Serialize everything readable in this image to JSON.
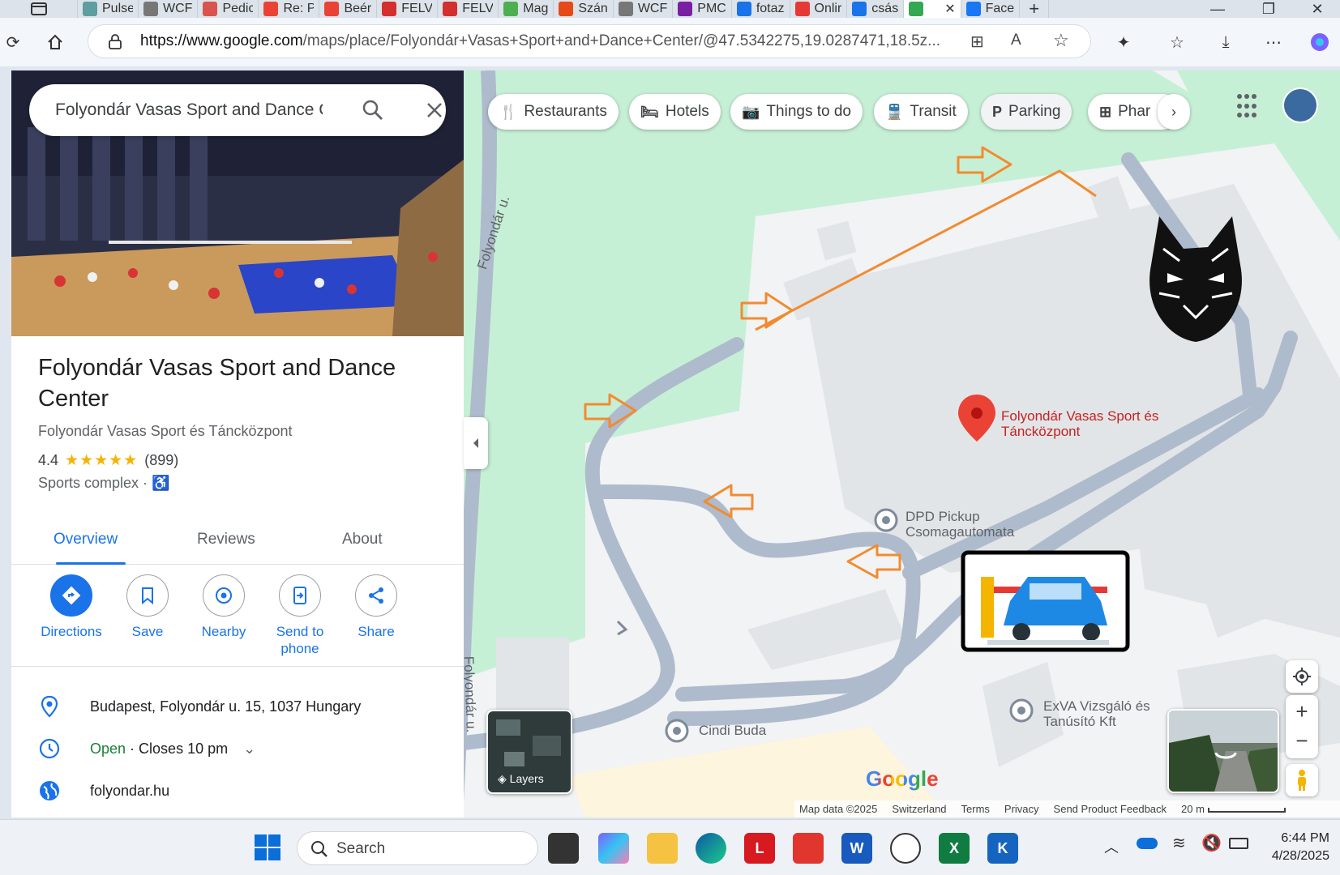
{
  "browser": {
    "tabs": [
      {
        "title": "Pulse",
        "color": "#5f9ea0"
      },
      {
        "title": "WCF",
        "color": "#777777"
      },
      {
        "title": "Pedic",
        "color": "#d9534f"
      },
      {
        "title": "Re: P",
        "color": "#ea4335"
      },
      {
        "title": "Beér",
        "color": "#ea4335"
      },
      {
        "title": "FELV",
        "color": "#d32f2f"
      },
      {
        "title": "FELV",
        "color": "#d32f2f"
      },
      {
        "title": "Mag",
        "color": "#4caf50"
      },
      {
        "title": "Szán",
        "color": "#e64a19"
      },
      {
        "title": "WCF",
        "color": "#777777"
      },
      {
        "title": "PMC",
        "color": "#7b1fa2"
      },
      {
        "title": "fotaz",
        "color": "#1a73e8"
      },
      {
        "title": "Onlir",
        "color": "#e53935"
      },
      {
        "title": "csás",
        "color": "#1a73e8"
      },
      {
        "title": "",
        "color": "#34a853"
      },
      {
        "title": "Face",
        "color": "#1877f2"
      }
    ],
    "url_domain": "https://www.google.com",
    "url_path": "/maps/place/Folyondár+Vasas+Sport+and+Dance+Center/@47.5342275,19.0287471,18.5z..."
  },
  "search": {
    "query": "Folyondár Vasas Sport and Dance C"
  },
  "place": {
    "title": "Folyondár Vasas Sport and Dance Center",
    "subtitle": "Folyondár Vasas Sport és Táncközpont",
    "rating": "4.4",
    "stars": "★★★★★",
    "reviews_count": "(899)",
    "category": "Sports complex ·",
    "tabs": [
      "Overview",
      "Reviews",
      "About"
    ],
    "actions": [
      {
        "label": "Directions"
      },
      {
        "label": "Save"
      },
      {
        "label": "Nearby"
      },
      {
        "label": "Send to phone"
      },
      {
        "label": "Share"
      }
    ],
    "address": "Budapest, Folyondár u. 15, 1037 Hungary",
    "hours_open": "Open",
    "hours_close": " · Closes 10 pm",
    "website": "folyondar.hu"
  },
  "map": {
    "chips": [
      "Restaurants",
      "Hotels",
      "Things to do",
      "Transit",
      "Parking",
      "Phar"
    ],
    "street_1": "Folyondár u.",
    "street_2": "Folyondár u.",
    "place_pin_label": "Folyondár Vasas Sport és Táncközpont",
    "dpd_label": "DPD Pickup Csomagautomata",
    "cindi_label": "Cindi Buda",
    "exva_label": "ExVA Vizsgáló és Tanúsító Kft",
    "layers_label": "Layers",
    "logo": "Google",
    "footer": {
      "map_data": "Map data ©2025",
      "country": "Switzerland",
      "terms": "Terms",
      "privacy": "Privacy",
      "feedback": "Send Product Feedback",
      "scale": "20 m"
    }
  },
  "taskbar": {
    "search_label": "Search",
    "time": "6:44 PM",
    "date": "4/28/2025"
  },
  "colors": {
    "accent": "#1a73e8",
    "route_orange": "#f28b30",
    "pin_red": "#ea4335"
  }
}
